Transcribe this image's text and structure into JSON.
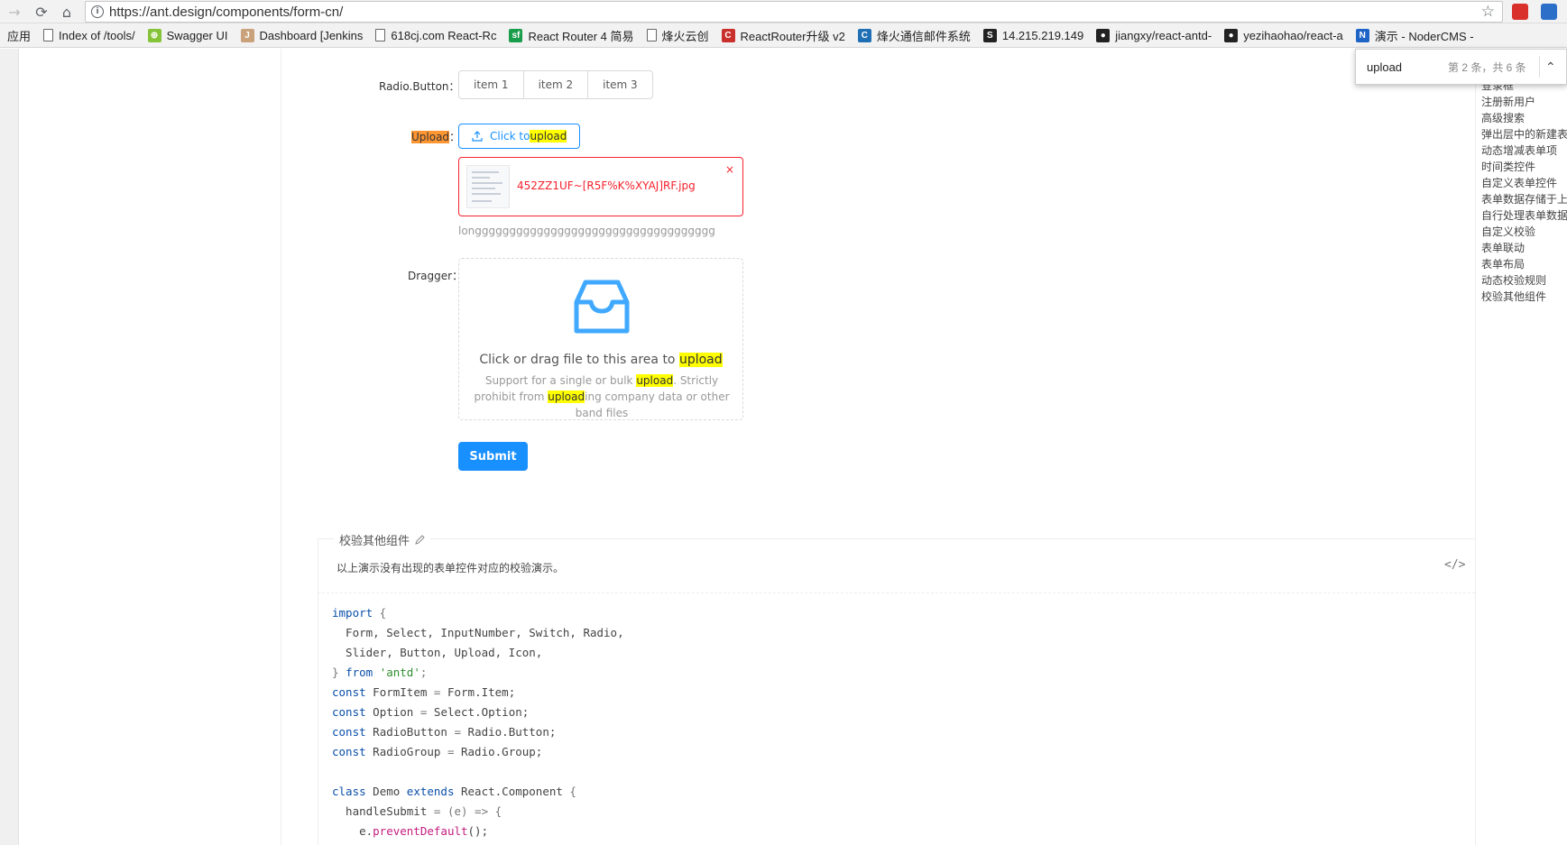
{
  "browser": {
    "url": "https://ant.design/components/form-cn/",
    "bookmarks": [
      {
        "label": "应用",
        "icon": "apps-icon"
      },
      {
        "label": "Index of /tools/",
        "icon": "page-icon"
      },
      {
        "label": "Swagger UI",
        "icon": "swagger-icon"
      },
      {
        "label": "Dashboard [Jenkins",
        "icon": "jenkins-icon"
      },
      {
        "label": "618cj.com React-Rc",
        "icon": "page-icon"
      },
      {
        "label": "React Router 4 简易",
        "icon": "sf-icon"
      },
      {
        "label": "烽火云创",
        "icon": "page-icon"
      },
      {
        "label": "ReactRouter升级 v2",
        "icon": "c-red-icon"
      },
      {
        "label": "烽火通信邮件系统",
        "icon": "c-blue-icon"
      },
      {
        "label": "14.215.219.149",
        "icon": "s-icon"
      },
      {
        "label": "jiangxy/react-antd-",
        "icon": "github-icon"
      },
      {
        "label": "yezihaohao/react-a",
        "icon": "github-icon"
      },
      {
        "label": "演示 - NoderCMS -",
        "icon": "n-icon"
      }
    ]
  },
  "findbar": {
    "query": "upload",
    "count": "第 2 条，共 6 条"
  },
  "form": {
    "radio_label": "Radio.Button",
    "radio_items": [
      "item 1",
      "item 2",
      "item 3"
    ],
    "upload_label": "Upload",
    "upload_btn_prefix": "Click to ",
    "upload_btn_hl": "upload",
    "file_name": "452ZZ1UF~[R5F%K%XYAJ]RF.jpg",
    "file_remove": "×",
    "extra": "longgggggggggggggggggggggggggggggggggg",
    "dragger_label": "Dragger",
    "dragger_title_prefix": "Click or drag file to this area to ",
    "dragger_title_hl": "upload",
    "dragger_hint_1": "Support for a single or bulk ",
    "dragger_hint_hl1": "upload",
    "dragger_hint_2": ". Strictly prohibit from ",
    "dragger_hint_hl2": "upload",
    "dragger_hint_3": "ing company data or other band files",
    "submit": "Submit"
  },
  "demo": {
    "title": "校验其他组件",
    "desc": "以上演示没有出现的表单控件对应的校验演示。",
    "code_toggle": "</>"
  },
  "code_lines": [
    [
      [
        "kw",
        "import"
      ],
      [
        "pn",
        " {"
      ]
    ],
    [
      [
        "",
        "  Form, Select, InputNumber, Switch, Radio,"
      ]
    ],
    [
      [
        "",
        "  Slider, Button, Upload, Icon,"
      ]
    ],
    [
      [
        "pn",
        "} "
      ],
      [
        "kw",
        "from"
      ],
      [
        "str",
        " 'antd'"
      ],
      [
        "pn",
        ";"
      ]
    ],
    [
      [
        "kw",
        "const"
      ],
      [
        "",
        " FormItem "
      ],
      [
        "pn",
        "="
      ],
      [
        "",
        " Form.Item;"
      ]
    ],
    [
      [
        "kw",
        "const"
      ],
      [
        "",
        " Option "
      ],
      [
        "pn",
        "="
      ],
      [
        "",
        " Select.Option;"
      ]
    ],
    [
      [
        "kw",
        "const"
      ],
      [
        "",
        " RadioButton "
      ],
      [
        "pn",
        "="
      ],
      [
        "",
        " Radio.Button;"
      ]
    ],
    [
      [
        "kw",
        "const"
      ],
      [
        "",
        " RadioGroup "
      ],
      [
        "pn",
        "="
      ],
      [
        "",
        " Radio.Group;"
      ]
    ],
    [
      [
        "",
        ""
      ]
    ],
    [
      [
        "kw",
        "class"
      ],
      [
        "",
        " Demo "
      ],
      [
        "kw",
        "extends"
      ],
      [
        "",
        " React.Component "
      ],
      [
        "pn",
        "{"
      ]
    ],
    [
      [
        "",
        "  handleSubmit "
      ],
      [
        "pn",
        "= (e) => {"
      ]
    ],
    [
      [
        "",
        "    e."
      ],
      [
        "fn",
        "preventDefault"
      ],
      [
        "",
        "();"
      ]
    ]
  ],
  "anchors": [
    "登录框",
    "注册新用户",
    "高级搜索",
    "弹出层中的新建表单",
    "动态增减表单项",
    "时间类控件",
    "自定义表单控件",
    "表单数据存储于上层组件",
    "自行处理表单数据",
    "自定义校验",
    "表单联动",
    "表单布局",
    "动态校验规则",
    "校验其他组件"
  ]
}
